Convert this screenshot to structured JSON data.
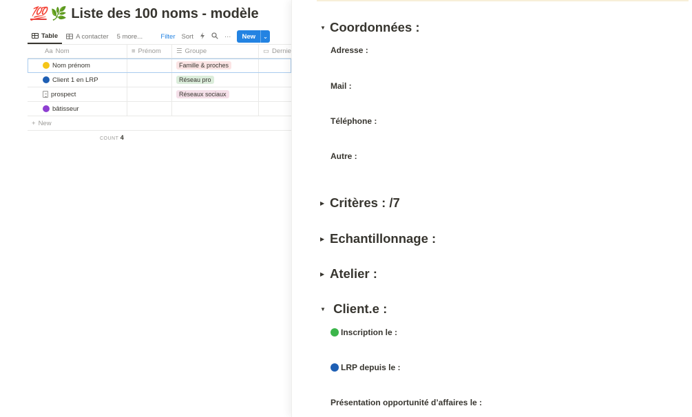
{
  "page": {
    "title": "Liste des 100 noms - modèle",
    "title_emojis": [
      "💯",
      "🌿"
    ]
  },
  "toolbar": {
    "tab_table": "Table",
    "tab_contacter": "A contacter",
    "more_views": "5 more...",
    "filter": "Filter",
    "sort": "Sort",
    "new": "New"
  },
  "table": {
    "columns": [
      "Nom",
      "Prénom",
      "Groupe",
      "Dernie"
    ],
    "column_prefixes": {
      "nom": "Aa"
    },
    "rows": [
      {
        "nom": "Nom prénom",
        "prenom": "",
        "groupe": "Famille & proches",
        "icon_color": "#f5c518"
      },
      {
        "nom": "Client 1 en LRP",
        "prenom": "",
        "groupe": "Réseau pro",
        "icon_color": "#1e5fb4"
      },
      {
        "nom": "prospect",
        "prenom": "",
        "groupe": "Réseaux sociaux",
        "icon_color": "page"
      },
      {
        "nom": "bâtisseur",
        "prenom": "",
        "groupe": "",
        "icon_color": "#8e3fd1"
      }
    ],
    "tag_colors": {
      "Famille & proches": "#fbe4e4",
      "Réseau pro": "#dbeddb",
      "Réseaux sociaux": "#f5e0e9"
    },
    "new_row_label": "New",
    "count_label": "COUNT",
    "count_value": "4"
  },
  "peek": {
    "sections": [
      {
        "title": "Coordonnées :",
        "expanded": true
      },
      {
        "title": "Critères : /7",
        "expanded": false
      },
      {
        "title": "Echantillonnage :",
        "expanded": false
      },
      {
        "title": "Atelier :",
        "expanded": false
      },
      {
        "title": " Client.e :",
        "expanded": true
      }
    ],
    "coordonnees_fields": [
      "Adresse :",
      "Mail :",
      "Téléphone :",
      "Autre :"
    ],
    "client_fields": [
      {
        "label": "Inscription le :",
        "dot": "#3bb54a"
      },
      {
        "label": "LRP depuis le :",
        "dot": "#1e5fb4"
      },
      {
        "label": "Présentation opportunité d’affaires le :",
        "dot": ""
      }
    ]
  }
}
